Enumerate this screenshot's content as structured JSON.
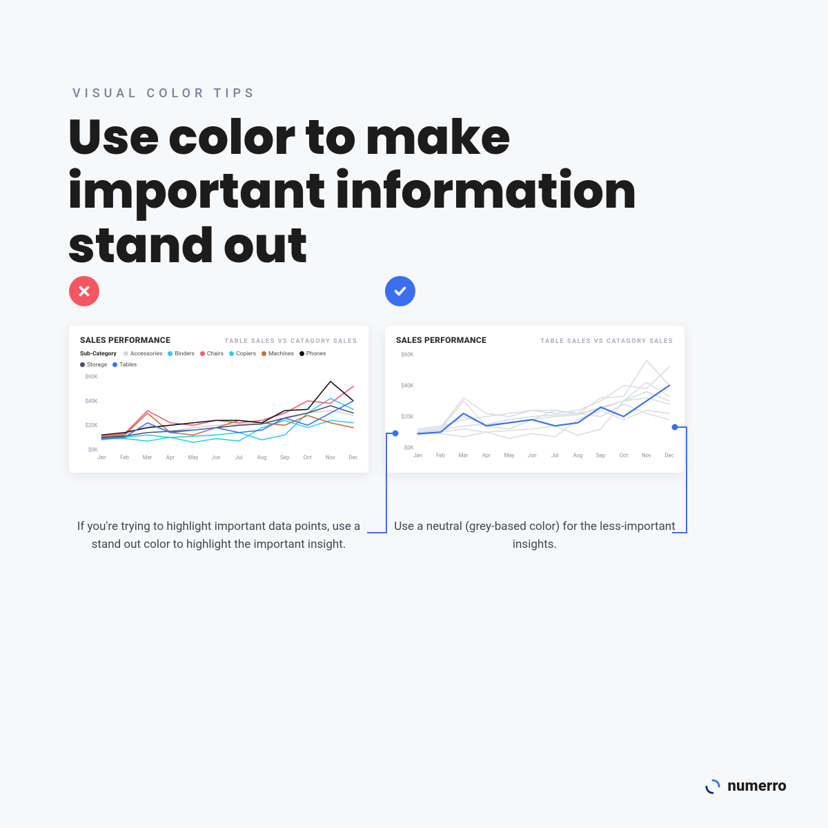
{
  "eyebrow": "VISUAL COLOR TIPS",
  "headline": "Use color to make important information stand out",
  "brand": "numerro",
  "card": {
    "title": "SALES PERFORMANCE",
    "subtitle": "TABLE SALES VS CATAGORY SALES",
    "legend_label": "Sub-Category"
  },
  "captions": {
    "left": "If you're trying to highlight important data points, use a stand out color to highlight the important insight.",
    "right": "Use a neutral (grey-based color) for the less-important insights."
  },
  "chart_data": {
    "type": "line",
    "title": "SALES PERFORMANCE",
    "subtitle": "TABLE SALES VS CATAGORY SALES",
    "xlabel": "",
    "ylabel": "",
    "ylim": [
      0,
      60
    ],
    "y_unit": "$K",
    "y_ticks": [
      0,
      20,
      40,
      60
    ],
    "categories": [
      "Jan",
      "Feb",
      "Mar",
      "Apr",
      "May",
      "Jun",
      "Jul",
      "Aug",
      "Sep",
      "Oct",
      "Nov",
      "Dec"
    ],
    "series": [
      {
        "name": "Accessories",
        "color_left": "#d6d6d6",
        "color_right": "#d9dde3",
        "values": [
          10,
          12,
          20,
          15,
          18,
          20,
          21,
          22,
          25,
          30,
          32,
          28
        ]
      },
      {
        "name": "Binders",
        "color_left": "#35c6f4",
        "color_right": "#d9dde3",
        "values": [
          8,
          10,
          12,
          10,
          11,
          12,
          14,
          8,
          12,
          30,
          42,
          33
        ]
      },
      {
        "name": "Chairs",
        "color_left": "#f25a72",
        "color_right": "#d9dde3",
        "values": [
          11,
          13,
          32,
          22,
          20,
          24,
          22,
          24,
          30,
          40,
          38,
          52
        ]
      },
      {
        "name": "Copiers",
        "color_left": "#2bd0e8",
        "color_right": "#d9dde3",
        "values": [
          9,
          9,
          7,
          10,
          6,
          9,
          7,
          18,
          24,
          18,
          24,
          22
        ]
      },
      {
        "name": "Machines",
        "color_left": "#c96a3a",
        "color_right": "#d9dde3",
        "values": [
          10,
          12,
          30,
          14,
          12,
          18,
          24,
          22,
          20,
          28,
          22,
          18
        ]
      },
      {
        "name": "Phones",
        "color_left": "#111111",
        "color_right": "#d9dde3",
        "values": [
          12,
          14,
          18,
          20,
          22,
          24,
          24,
          22,
          32,
          33,
          56,
          40
        ]
      },
      {
        "name": "Storage",
        "color_left": "#4a4f63",
        "color_right": "#d9dde3",
        "values": [
          10,
          11,
          14,
          15,
          16,
          18,
          20,
          21,
          26,
          30,
          36,
          30
        ]
      },
      {
        "name": "Tables",
        "color_left": "#3a6ff0",
        "color_right": "#3a6ff0",
        "values": [
          9,
          10,
          22,
          14,
          16,
          18,
          14,
          16,
          26,
          20,
          30,
          40
        ],
        "highlight": true
      }
    ],
    "panels": [
      {
        "id": "left",
        "style": "multicolor"
      },
      {
        "id": "right",
        "style": "highlight-vs-grey"
      }
    ]
  }
}
